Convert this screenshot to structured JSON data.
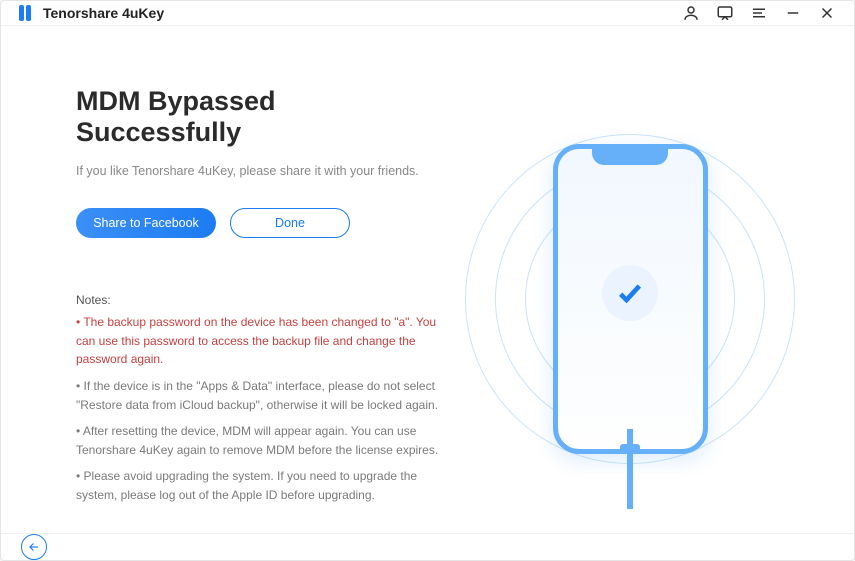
{
  "app": {
    "title": "Tenorshare 4uKey"
  },
  "titlebar": {
    "icons": {
      "account": "account-icon",
      "feedback": "feedback-icon",
      "menu": "menu-icon",
      "minimize": "minimize-icon",
      "close": "close-icon"
    }
  },
  "main": {
    "heading": "MDM Bypassed Successfully",
    "subtext": "If you like Tenorshare 4uKey, please share it with your friends.",
    "buttons": {
      "share": "Share to Facebook",
      "done": "Done"
    },
    "notes_label": "Notes:",
    "notes": [
      {
        "text": "• The backup password on the device has been changed to \"a\". You can use this password to access the backup file and change the password again.",
        "warn": true
      },
      {
        "text": "• If the device is in the \"Apps & Data\" interface, please do not select \"Restore data from iCloud backup\", otherwise it will be locked again.",
        "warn": false
      },
      {
        "text": "• After resetting the device, MDM will appear again. You can use Tenorshare 4uKey again to remove MDM before the license expires.",
        "warn": false
      },
      {
        "text": "• Please avoid upgrading the system. If you need to upgrade the system, please log out of the Apple ID before upgrading.",
        "warn": false
      }
    ]
  },
  "illustration": {
    "icon": "checkmark-icon"
  },
  "footer": {
    "back": "back"
  },
  "colors": {
    "primary": "#1c7cf2",
    "warn": "#c84040",
    "text": "#2b2b2b",
    "muted": "#888"
  }
}
